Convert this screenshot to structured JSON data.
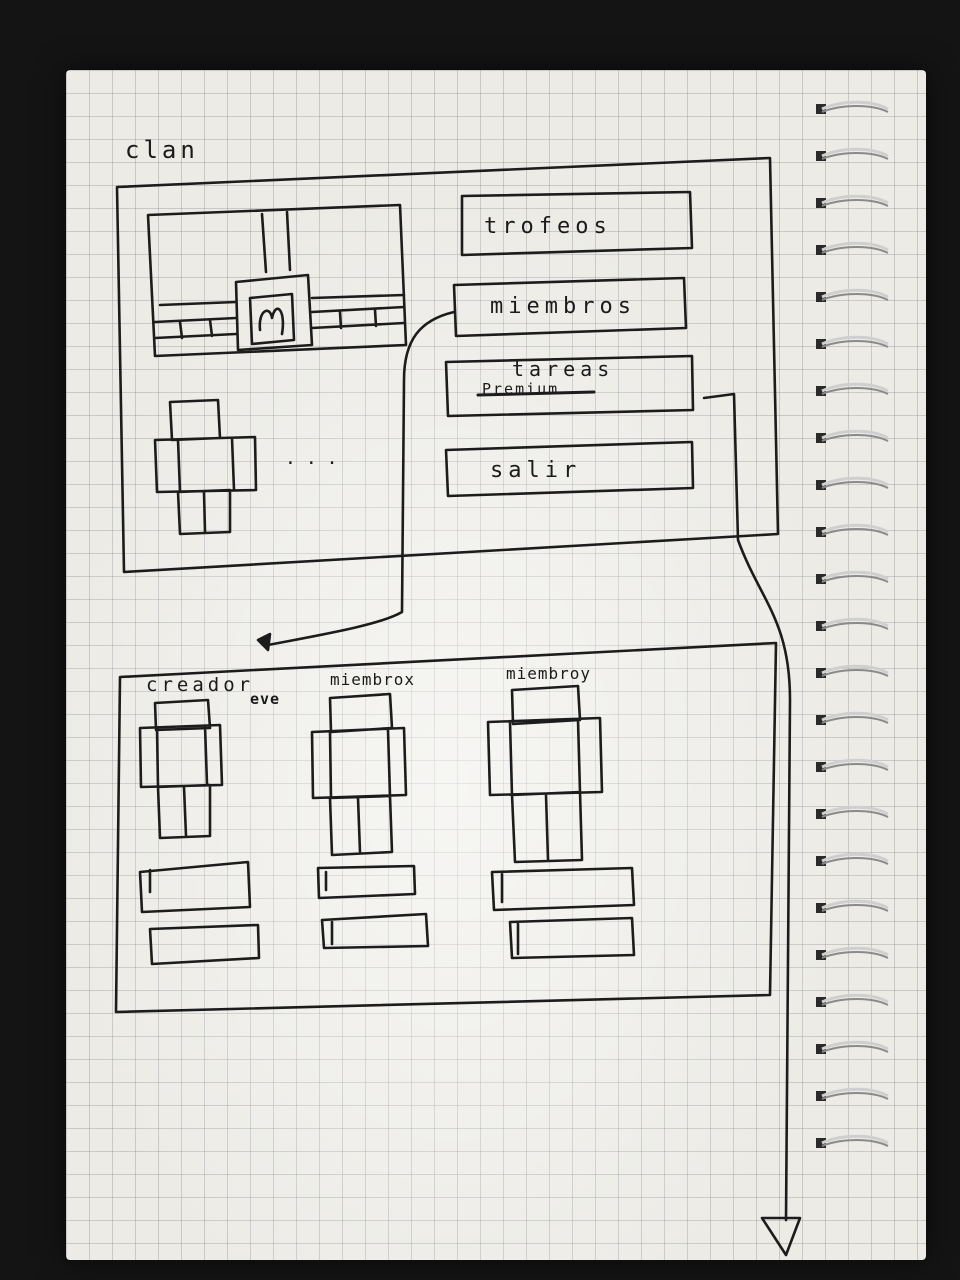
{
  "sketch": {
    "title": "clan",
    "menu": {
      "trofeos": "trofeos",
      "miembros": "miembros",
      "tareas": "tareas",
      "tareas_crossed": "Premium",
      "salir": "salir"
    },
    "ellipsis": "...",
    "members": {
      "creador": "creador",
      "creador_note": "eve",
      "miembro_x": "miembrox",
      "miembro_y": "miembroy"
    }
  }
}
